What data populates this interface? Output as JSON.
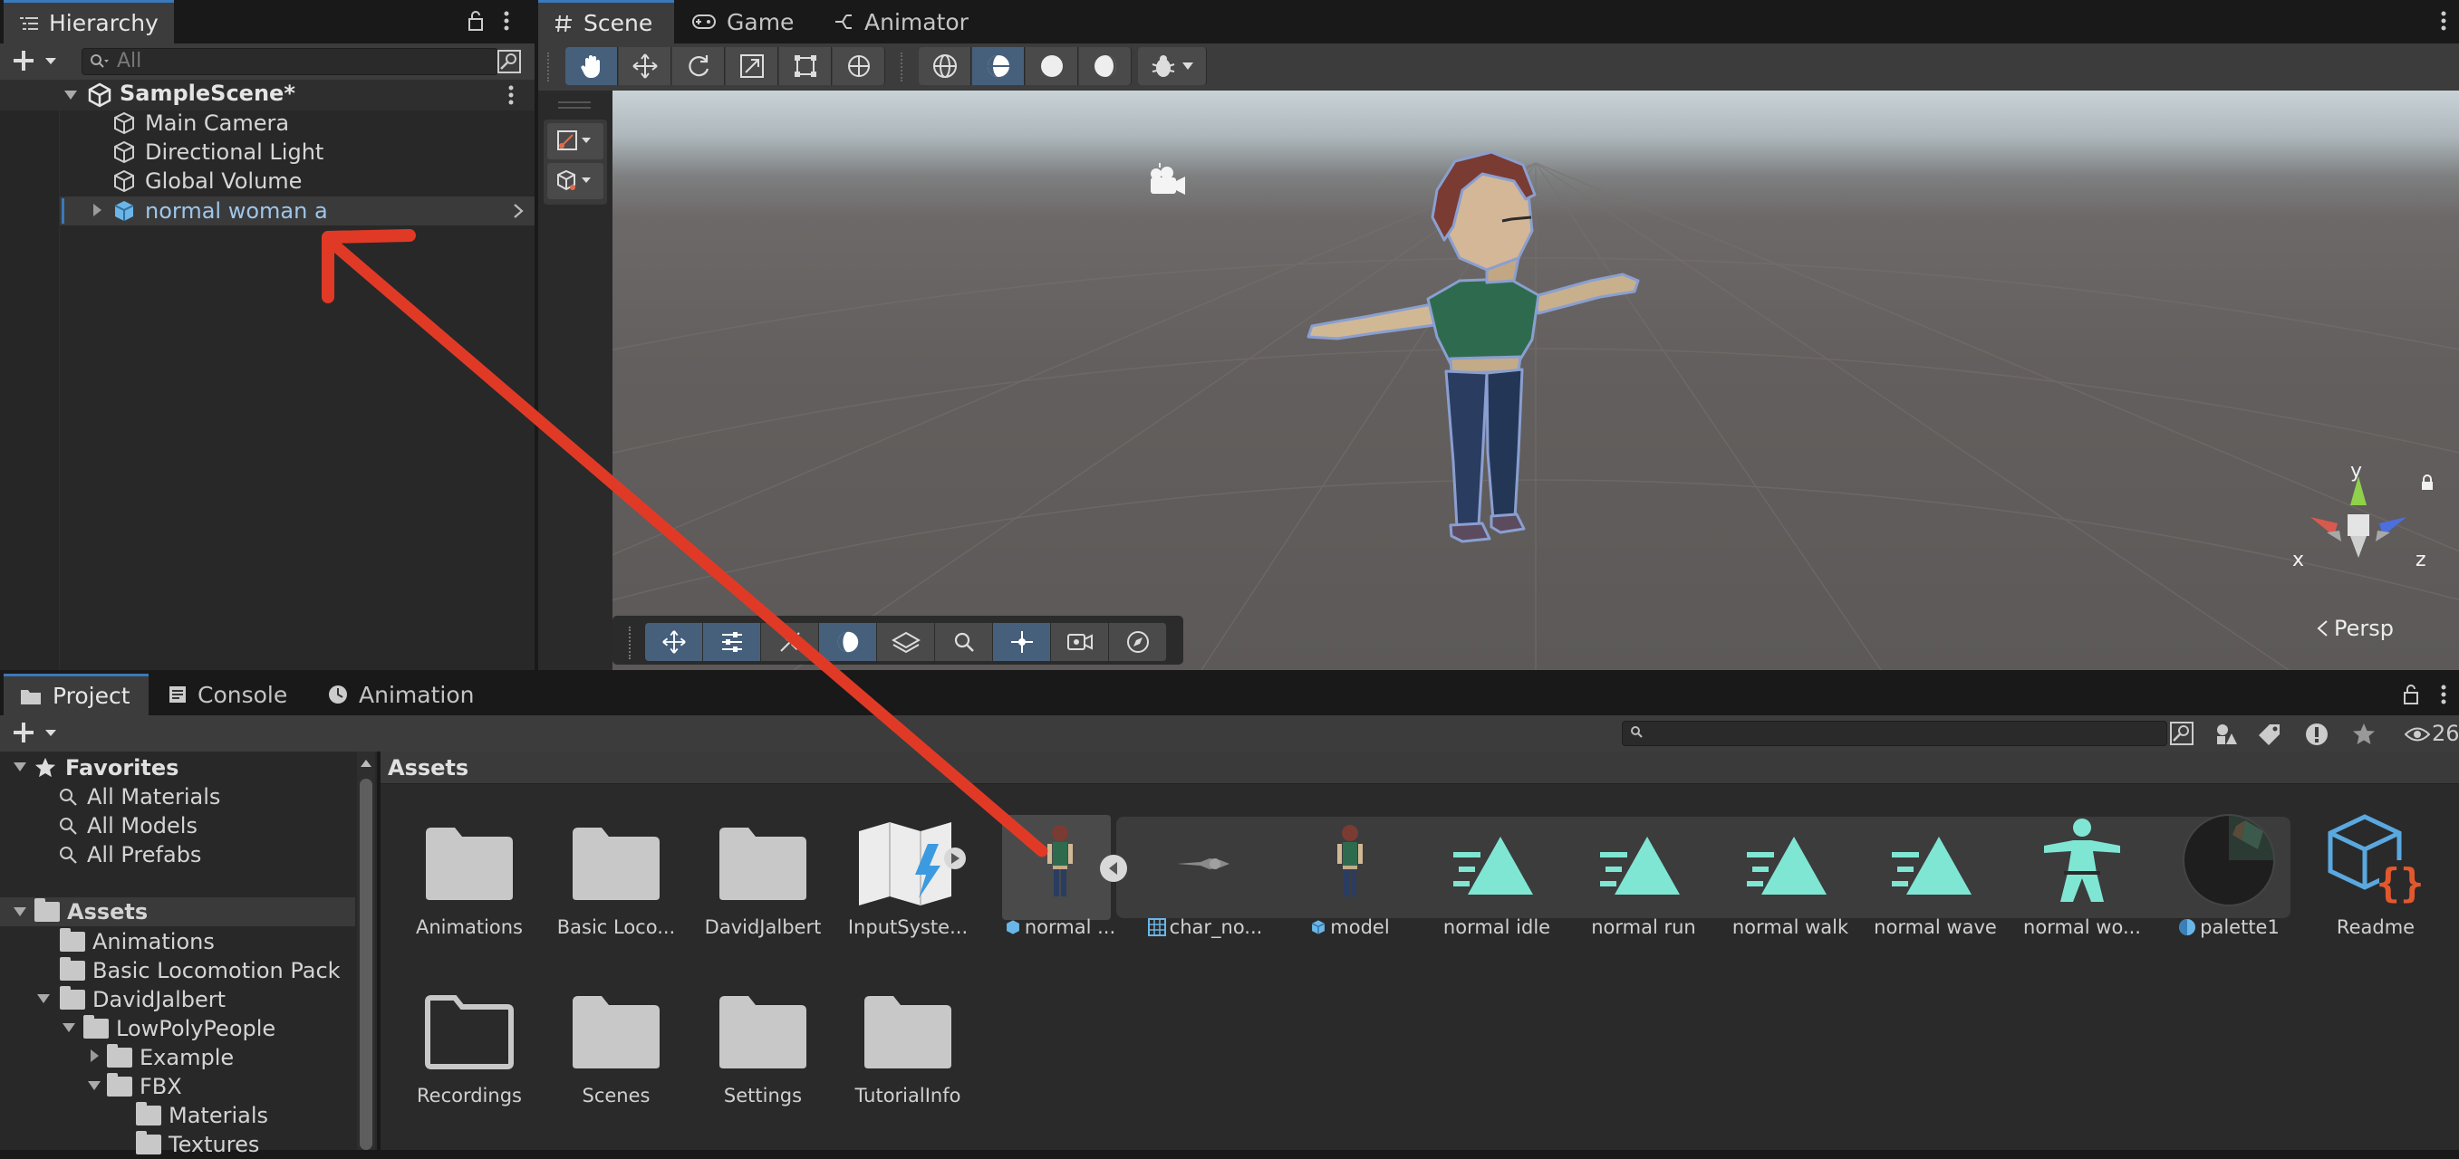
{
  "hierarchy": {
    "tab_label": "Hierarchy",
    "search_placeholder": "All",
    "scene_name": "SampleScene*",
    "items": [
      {
        "label": "Main Camera"
      },
      {
        "label": "Directional Light"
      },
      {
        "label": "Global Volume"
      },
      {
        "label": "normal woman a"
      }
    ]
  },
  "scene_tabs": [
    {
      "label": "Scene"
    },
    {
      "label": "Game"
    },
    {
      "label": "Animator"
    }
  ],
  "scene_view": {
    "gizmo_axes": {
      "x": "x",
      "y": "y",
      "z": "z"
    },
    "projection_label": "Persp"
  },
  "bottom_tabs": [
    {
      "label": "Project"
    },
    {
      "label": "Console"
    },
    {
      "label": "Animation"
    }
  ],
  "project": {
    "visible_count": "26",
    "breadcrumb": "Assets",
    "favorites": {
      "label": "Favorites",
      "items": [
        {
          "label": "All Materials"
        },
        {
          "label": "All Models"
        },
        {
          "label": "All Prefabs"
        }
      ]
    },
    "assets_root": "Assets",
    "tree": [
      {
        "label": "Animations"
      },
      {
        "label": "Basic Locomotion Pack"
      },
      {
        "label": "DavidJalbert"
      },
      {
        "label": "LowPolyPeople"
      },
      {
        "label": "Example"
      },
      {
        "label": "FBX"
      },
      {
        "label": "Materials"
      },
      {
        "label": "Textures"
      }
    ],
    "grid_row1": [
      {
        "label": "Animations"
      },
      {
        "label": "Basic Loco..."
      },
      {
        "label": "DavidJalbert"
      },
      {
        "label": "InputSyste..."
      },
      {
        "label": "normal ..."
      },
      {
        "label": "char_no..."
      },
      {
        "label": "model"
      },
      {
        "label": "normal idle"
      },
      {
        "label": "normal run"
      },
      {
        "label": "normal walk"
      },
      {
        "label": "normal wave"
      },
      {
        "label": "normal wo..."
      },
      {
        "label": "palette1"
      },
      {
        "label": "Readme"
      }
    ],
    "grid_row2": [
      {
        "label": "Recordings"
      },
      {
        "label": "Scenes"
      },
      {
        "label": "Settings"
      },
      {
        "label": "TutorialInfo"
      }
    ]
  },
  "colors": {
    "accent": "#3a79bb",
    "annotation_arrow": "#e03a26",
    "anim_clip": "#7fe6d4",
    "folder": "#c8c8c8"
  }
}
